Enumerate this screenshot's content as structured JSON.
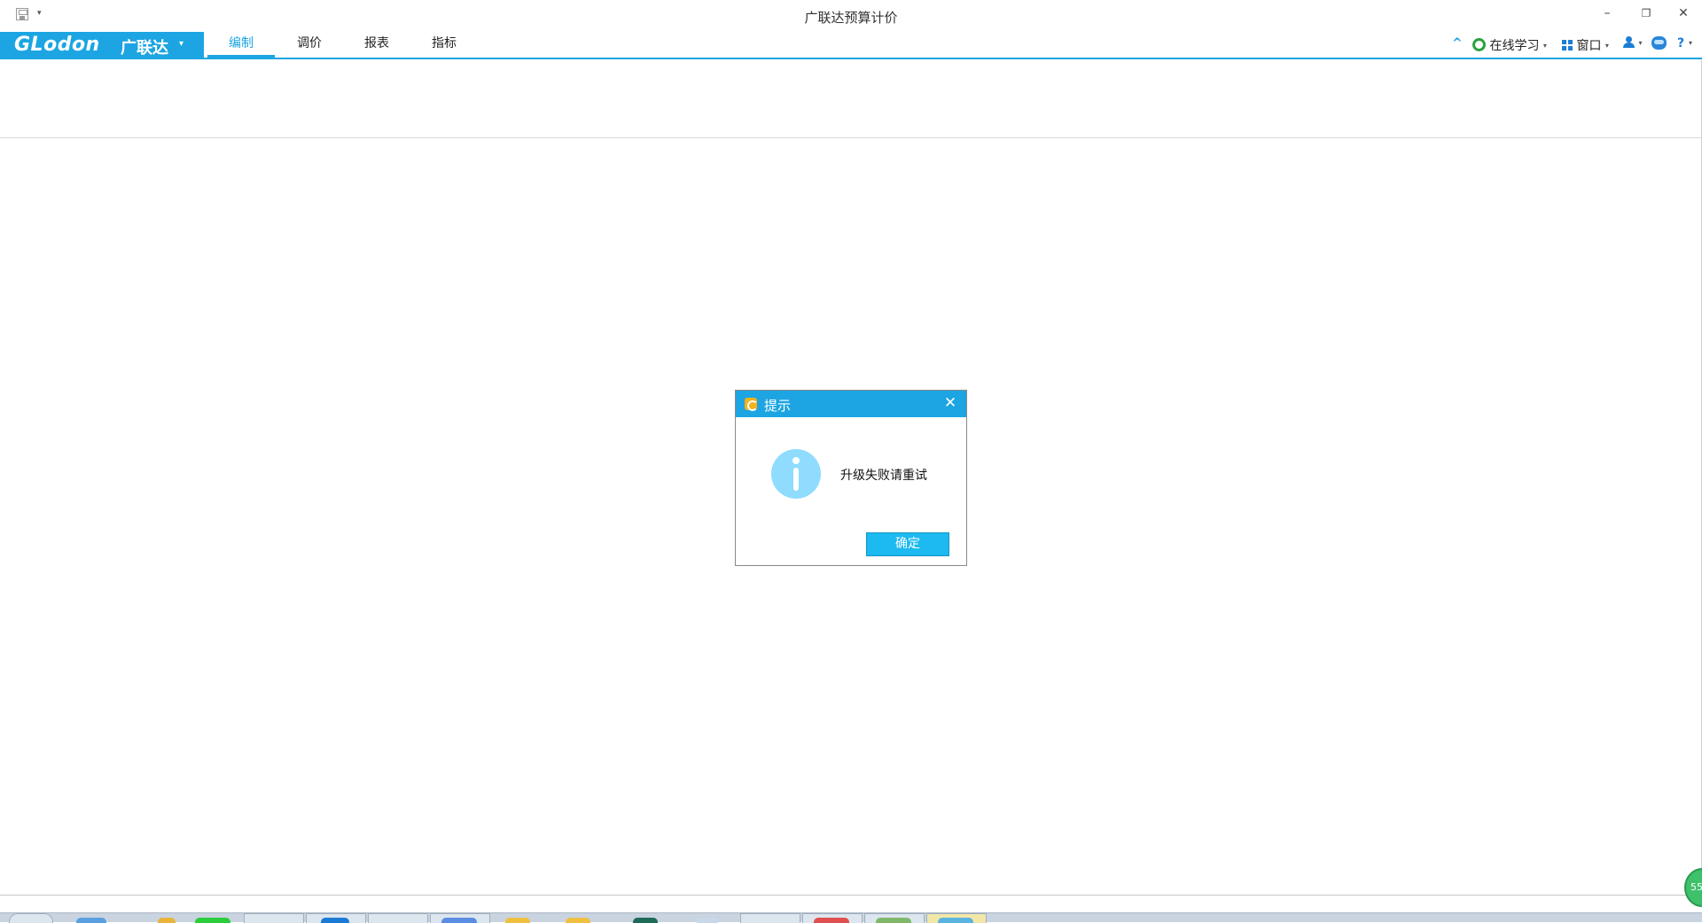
{
  "window": {
    "title": "广联达预算计价",
    "min_glyph": "–",
    "restore_glyph": "❐",
    "close_glyph": "✕",
    "quick_access_drop": "▾"
  },
  "ribbon": {
    "logo_text": "GLodon",
    "logo_cn": "广联达",
    "logo_caret": "▾",
    "tabs": [
      {
        "label": "编制",
        "active": true
      },
      {
        "label": "调价",
        "active": false
      },
      {
        "label": "报表",
        "active": false
      },
      {
        "label": "指标",
        "active": false
      }
    ],
    "right_tools": {
      "collapse_glyph": "^",
      "online_learning": "在线学习",
      "window_menu": "窗口",
      "help_glyph": "?",
      "caret": "▾"
    }
  },
  "dialog": {
    "title": "提示",
    "close_glyph": "✕",
    "message": "升级失败请重试",
    "ok_label": "确定"
  },
  "floating_badge": {
    "text": "55"
  },
  "colors": {
    "accent": "#1ca5e2",
    "info_icon": "#8fdcff",
    "ok_button": "#1cbaf0",
    "learn_icon": "#2aa33d"
  }
}
